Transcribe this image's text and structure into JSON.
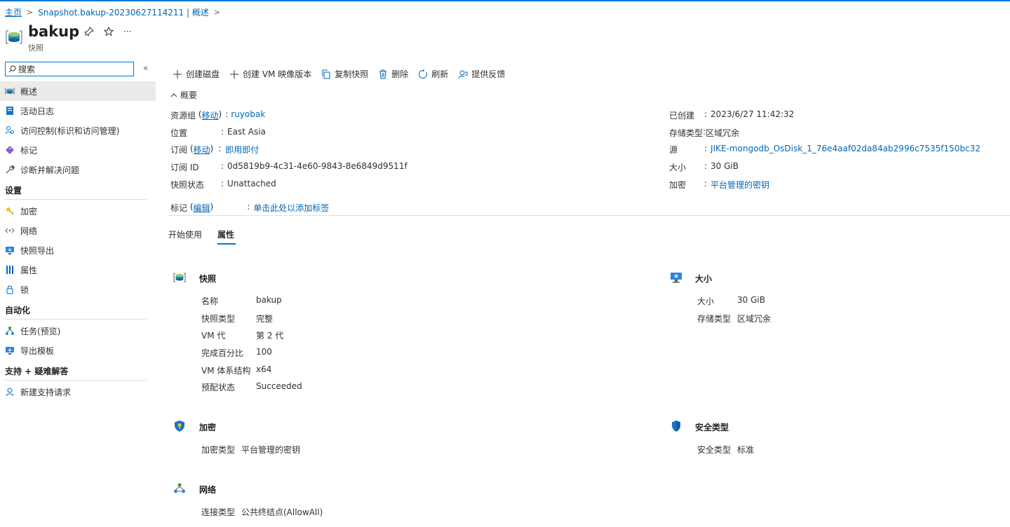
{
  "breadcrumb": {
    "home": "主页",
    "current": "Snapshot.bakup-20230627114211 | 概述"
  },
  "header": {
    "title": "bakup",
    "subtitle": "快照"
  },
  "sidebar": {
    "search_placeholder": "搜索",
    "collapse_glyph": "«",
    "items": [
      {
        "label": "概述",
        "icon": "snapshot-icon"
      },
      {
        "label": "活动日志",
        "icon": "activity-log-icon"
      },
      {
        "label": "访问控制(标识和访问管理)",
        "icon": "access-control-icon"
      },
      {
        "label": "标记",
        "icon": "tag-icon"
      },
      {
        "label": "诊断并解决问题",
        "icon": "wrench-icon"
      }
    ],
    "groups": [
      {
        "title": "设置",
        "items": [
          {
            "label": "加密",
            "icon": "key-icon"
          },
          {
            "label": "网络",
            "icon": "network-icon"
          },
          {
            "label": "快照导出",
            "icon": "export-icon"
          },
          {
            "label": "属性",
            "icon": "properties-icon"
          },
          {
            "label": "锁",
            "icon": "lock-icon"
          }
        ]
      },
      {
        "title": "自动化",
        "items": [
          {
            "label": "任务(预览)",
            "icon": "tasks-icon"
          },
          {
            "label": "导出模板",
            "icon": "template-icon"
          }
        ]
      },
      {
        "title": "支持 + 疑难解答",
        "items": [
          {
            "label": "新建支持请求",
            "icon": "support-icon"
          }
        ]
      }
    ]
  },
  "toolbar": {
    "create_disk": "创建磁盘",
    "create_vm_image": "创建 VM 映像版本",
    "copy_snapshot": "复制快照",
    "delete": "删除",
    "refresh": "刷新",
    "feedback": "提供反馈"
  },
  "essentials": {
    "toggle_label": "概要",
    "left": [
      {
        "label": "资源组",
        "link": "移动",
        "value": "ruyobak",
        "value_link": true
      },
      {
        "label": "位置",
        "value": "East Asia"
      },
      {
        "label": "订阅",
        "link": "移动",
        "value": "即用即付",
        "value_link": true
      },
      {
        "label": "订阅 ID",
        "value": "0d5819b9-4c31-4e60-9843-8e6849d9511f"
      },
      {
        "label": "快照状态",
        "value": "Unattached"
      }
    ],
    "right": [
      {
        "label": "已创建",
        "value": "2023/6/27 11:42:32"
      },
      {
        "label": "存储类型",
        "value": "区域冗余"
      },
      {
        "label": "源",
        "value": "JIKE-mongodb_OsDisk_1_76e4aaf02da84ab2996c7535f150bc32",
        "value_link": true
      },
      {
        "label": "大小",
        "value": "30 GiB"
      },
      {
        "label": "加密",
        "value": "平台管理的密钥",
        "value_link": true
      }
    ],
    "tags": {
      "label": "标记",
      "link": "编辑",
      "value": "单击此处以添加标签"
    }
  },
  "tabs": [
    "开始使用",
    "属性"
  ],
  "properties": {
    "snapshot": {
      "title": "快照",
      "rows": [
        {
          "label": "名称",
          "value": "bakup"
        },
        {
          "label": "快照类型",
          "value": "完整"
        },
        {
          "label": "VM 代",
          "value": "第 2 代"
        },
        {
          "label": "完成百分比",
          "value": "100"
        },
        {
          "label": "VM 体系结构",
          "value": "x64"
        },
        {
          "label": "预配状态",
          "value": "Succeeded"
        }
      ]
    },
    "size": {
      "title": "大小",
      "rows": [
        {
          "label": "大小",
          "value": "30 GiB"
        },
        {
          "label": "存储类型",
          "value": "区域冗余"
        }
      ]
    },
    "encryption": {
      "title": "加密",
      "rows": [
        {
          "label": "加密类型",
          "value": "平台管理的密钥"
        }
      ]
    },
    "security": {
      "title": "安全类型",
      "rows": [
        {
          "label": "安全类型",
          "value": "标准"
        }
      ]
    },
    "network": {
      "title": "网络",
      "rows": [
        {
          "label": "连接类型",
          "value": "公共终结点(AllowAll)"
        }
      ]
    }
  },
  "colors": {
    "accent": "#0078d4",
    "link": "#0067b8",
    "active_bg": "#edebe9"
  }
}
